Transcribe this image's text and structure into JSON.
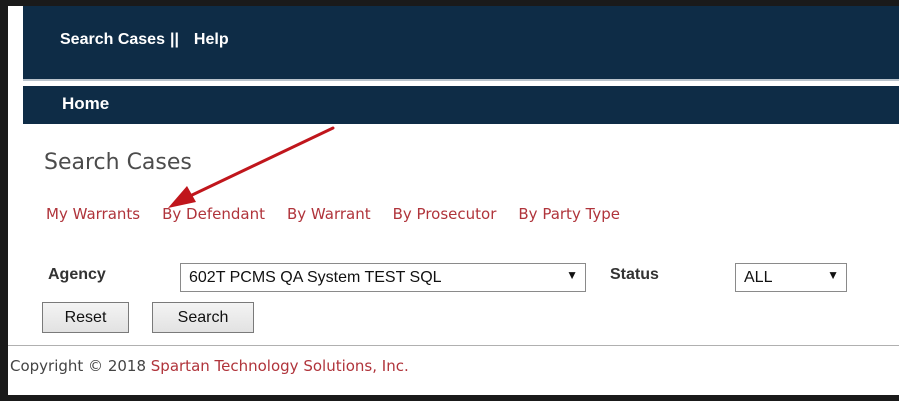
{
  "topnav": {
    "search_cases": "Search Cases",
    "separator": "||",
    "help": "Help"
  },
  "subnav": {
    "home": "Home"
  },
  "page": {
    "title": "Search Cases"
  },
  "search_links": [
    "My Warrants",
    "By Defendant",
    "By Warrant",
    "By Prosecutor",
    "By Party Type"
  ],
  "form": {
    "agency_label": "Agency",
    "agency_value": "602T PCMS QA System TEST SQL",
    "status_label": "Status",
    "status_value": "ALL",
    "reset_label": "Reset",
    "search_label": "Search"
  },
  "footer": {
    "prefix": "Copyright © 2018 ",
    "company": "Spartan Technology Solutions, Inc."
  },
  "colors": {
    "nav_bg": "#0e2c46",
    "link": "#b0343b",
    "annotation_arrow": "#c0161c"
  },
  "icons": {
    "dropdown": "triangle-down",
    "annotation": "red-arrow"
  }
}
